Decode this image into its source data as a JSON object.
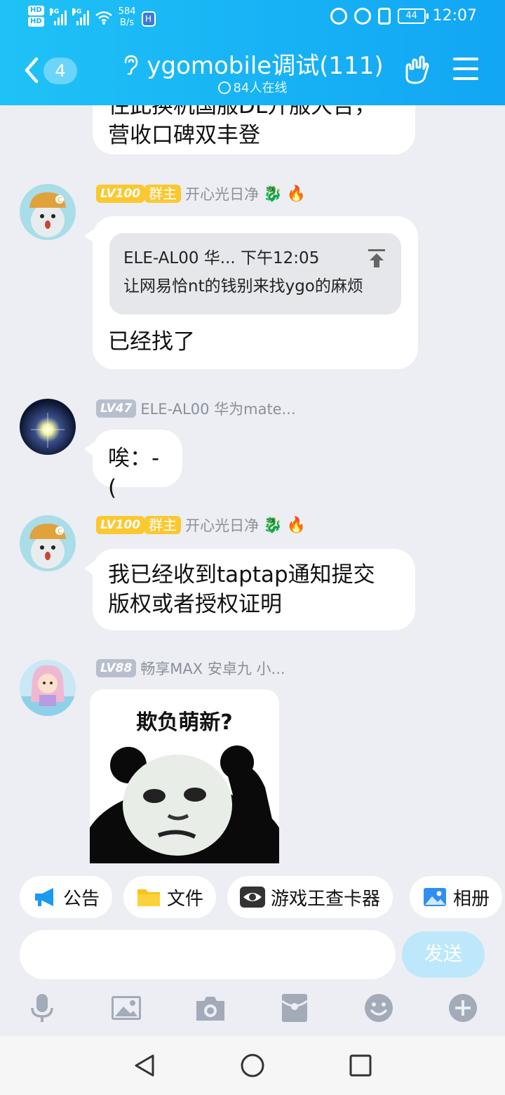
{
  "status_bar": {
    "network_speed_value": "584",
    "network_speed_unit": "B/s",
    "battery": "44",
    "time": "12:07",
    "signal1": "4G",
    "signal2": "4G"
  },
  "header": {
    "unread_count": "4",
    "title": "ygomobile调试(111)",
    "online": "84人在线"
  },
  "messages": [
    {
      "type": "text",
      "text_cut": "住此换机国服DL开服大吉，",
      "text": "营收口碑双丰登"
    },
    {
      "type": "reply",
      "level": "LV100",
      "role": "群主",
      "sender": "开心光日净",
      "quote_header": "ELE-AL00 华... 下午12:05",
      "quote_text": "让网易恰nt的钱别来找ygo的麻烦",
      "text": "已经找了"
    },
    {
      "type": "text",
      "level": "LV47",
      "sender": "ELE-AL00 华为mate...",
      "text": "唉：-("
    },
    {
      "type": "text",
      "level": "LV100",
      "role": "群主",
      "sender": "开心光日净",
      "text_line1": "我已经收到taptap通知提交",
      "text_line2": "版权或者授权证明"
    },
    {
      "type": "image",
      "level": "LV88",
      "sender": "畅享MAX 安卓九 小...",
      "sticker_caption": "欺负萌新?"
    }
  ],
  "shortcuts": [
    {
      "label": "公告",
      "icon": "megaphone-icon"
    },
    {
      "label": "文件",
      "icon": "folder-icon"
    },
    {
      "label": "游戏王查卡器",
      "icon": "eye-icon"
    },
    {
      "label": "相册",
      "icon": "photo-icon"
    }
  ],
  "composer": {
    "placeholder": "",
    "send_label": "发送"
  },
  "colors": {
    "header": "#17b2f5",
    "background": "#eceef4",
    "level_gold": "#fbc830",
    "level_gray": "#b8bfcc",
    "send_disabled": "#bde8fb"
  }
}
